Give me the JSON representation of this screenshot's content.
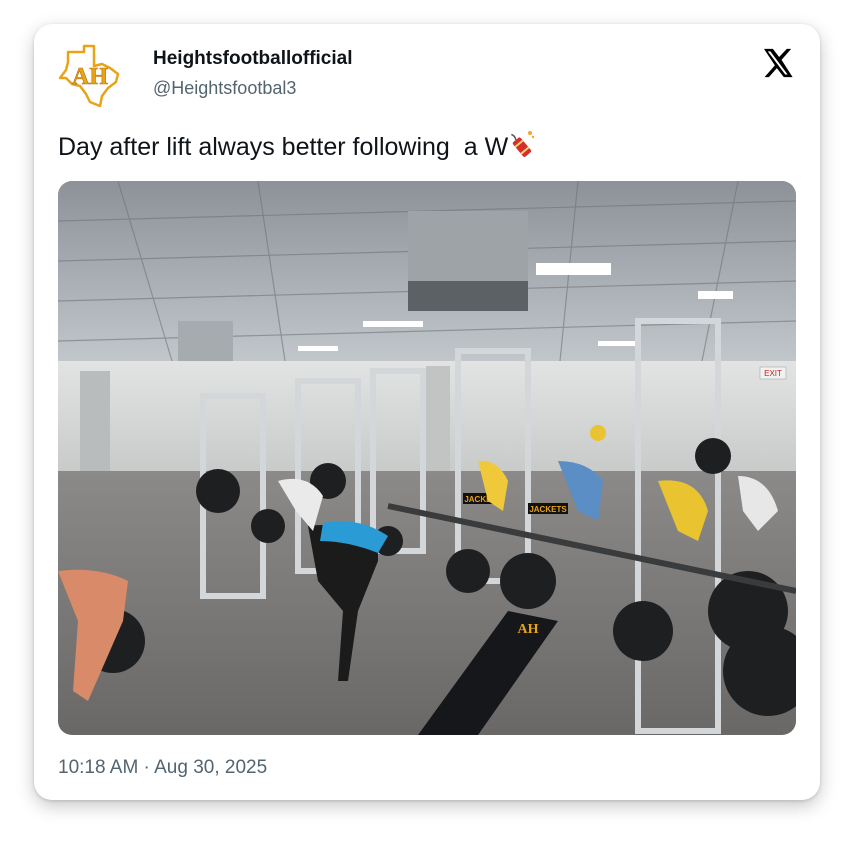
{
  "post": {
    "display_name": "Heightsfootballofficial",
    "handle": "@Heightsfootbal3",
    "text": "Day after lift always better following  a W",
    "emoji": "firecracker-icon",
    "timestamp": "10:18 AM · Aug 30, 2025",
    "avatar_letters": "AH",
    "bench_logo_letters": "AH",
    "rack_labels": [
      "JACKETS",
      "JACKETS"
    ],
    "exit_sign": "EXIT"
  },
  "colors": {
    "text_primary": "#0f1419",
    "text_secondary": "#536471",
    "brand_gold": "#e8a317",
    "x_logo": "#000000"
  },
  "icons": {
    "close": "x-logo-icon",
    "avatar": "texas-ah-logo-icon"
  }
}
